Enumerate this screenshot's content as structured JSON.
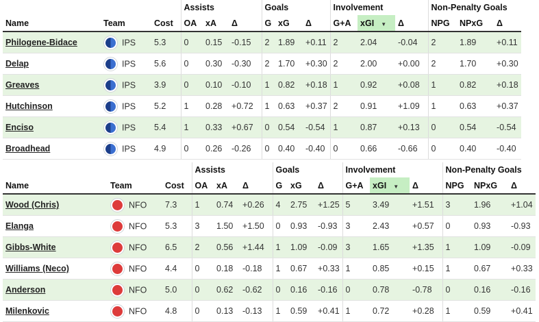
{
  "tables": [
    {
      "groups": [
        "Assists",
        "Goals",
        "Involvement",
        "Non-Penalty Goals"
      ],
      "columns": {
        "name": "Name",
        "team": "Team",
        "cost": "Cost",
        "oa": "OA",
        "xa": "xA",
        "da": "Δ",
        "g": "G",
        "xg": "xG",
        "dg": "Δ",
        "ga": "G+A",
        "xgi": "xGI",
        "dgi": "Δ",
        "npg": "NPG",
        "npxg": "NPxG",
        "dnp": "Δ"
      },
      "sort_indicator": "▼",
      "rows": [
        {
          "name": "Philogene-Bidace",
          "team": "IPS",
          "badge": "ips-crest-icon",
          "cost": "5.3",
          "oa": "0",
          "xa": "0.15",
          "da": "-0.15",
          "g": "2",
          "xg": "1.89",
          "dg": "+0.11",
          "ga": "2",
          "xgi": "2.04",
          "dgi": "-0.04",
          "npg": "2",
          "npxg": "1.89",
          "dnp": "+0.11"
        },
        {
          "name": "Delap",
          "team": "IPS",
          "badge": "ips-crest-icon",
          "cost": "5.6",
          "oa": "0",
          "xa": "0.30",
          "da": "-0.30",
          "g": "2",
          "xg": "1.70",
          "dg": "+0.30",
          "ga": "2",
          "xgi": "2.00",
          "dgi": "+0.00",
          "npg": "2",
          "npxg": "1.70",
          "dnp": "+0.30"
        },
        {
          "name": "Greaves",
          "team": "IPS",
          "badge": "ips-crest-icon",
          "cost": "3.9",
          "oa": "0",
          "xa": "0.10",
          "da": "-0.10",
          "g": "1",
          "xg": "0.82",
          "dg": "+0.18",
          "ga": "1",
          "xgi": "0.92",
          "dgi": "+0.08",
          "npg": "1",
          "npxg": "0.82",
          "dnp": "+0.18"
        },
        {
          "name": "Hutchinson",
          "team": "IPS",
          "badge": "ips-crest-icon",
          "cost": "5.2",
          "oa": "1",
          "xa": "0.28",
          "da": "+0.72",
          "g": "1",
          "xg": "0.63",
          "dg": "+0.37",
          "ga": "2",
          "xgi": "0.91",
          "dgi": "+1.09",
          "npg": "1",
          "npxg": "0.63",
          "dnp": "+0.37"
        },
        {
          "name": "Enciso",
          "team": "IPS",
          "badge": "ips-crest-icon",
          "cost": "5.4",
          "oa": "1",
          "xa": "0.33",
          "da": "+0.67",
          "g": "0",
          "xg": "0.54",
          "dg": "-0.54",
          "ga": "1",
          "xgi": "0.87",
          "dgi": "+0.13",
          "npg": "0",
          "npxg": "0.54",
          "dnp": "-0.54"
        },
        {
          "name": "Broadhead",
          "team": "IPS",
          "badge": "ips-crest-icon",
          "cost": "4.9",
          "oa": "0",
          "xa": "0.26",
          "da": "-0.26",
          "g": "0",
          "xg": "0.40",
          "dg": "-0.40",
          "ga": "0",
          "xgi": "0.66",
          "dgi": "-0.66",
          "npg": "0",
          "npxg": "0.40",
          "dnp": "-0.40"
        }
      ]
    },
    {
      "groups": [
        "Assists",
        "Goals",
        "Involvement",
        "Non-Penalty Goals"
      ],
      "columns": {
        "name": "Name",
        "team": "Team",
        "cost": "Cost",
        "oa": "OA",
        "xa": "xA",
        "da": "Δ",
        "g": "G",
        "xg": "xG",
        "dg": "Δ",
        "ga": "G+A",
        "xgi": "xGI",
        "dgi": "Δ",
        "npg": "NPG",
        "npxg": "NPxG",
        "dnp": "Δ"
      },
      "sort_indicator": "▼",
      "rows": [
        {
          "name": "Wood (Chris)",
          "team": "NFO",
          "badge": "nfo-crest-icon",
          "cost": "7.3",
          "oa": "1",
          "xa": "0.74",
          "da": "+0.26",
          "g": "4",
          "xg": "2.75",
          "dg": "+1.25",
          "ga": "5",
          "xgi": "3.49",
          "dgi": "+1.51",
          "npg": "3",
          "npxg": "1.96",
          "dnp": "+1.04"
        },
        {
          "name": "Elanga",
          "team": "NFO",
          "badge": "nfo-crest-icon",
          "cost": "5.3",
          "oa": "3",
          "xa": "1.50",
          "da": "+1.50",
          "g": "0",
          "xg": "0.93",
          "dg": "-0.93",
          "ga": "3",
          "xgi": "2.43",
          "dgi": "+0.57",
          "npg": "0",
          "npxg": "0.93",
          "dnp": "-0.93"
        },
        {
          "name": "Gibbs-White",
          "team": "NFO",
          "badge": "nfo-crest-icon",
          "cost": "6.5",
          "oa": "2",
          "xa": "0.56",
          "da": "+1.44",
          "g": "1",
          "xg": "1.09",
          "dg": "-0.09",
          "ga": "3",
          "xgi": "1.65",
          "dgi": "+1.35",
          "npg": "1",
          "npxg": "1.09",
          "dnp": "-0.09"
        },
        {
          "name": "Williams (Neco)",
          "team": "NFO",
          "badge": "nfo-crest-icon",
          "cost": "4.4",
          "oa": "0",
          "xa": "0.18",
          "da": "-0.18",
          "g": "1",
          "xg": "0.67",
          "dg": "+0.33",
          "ga": "1",
          "xgi": "0.85",
          "dgi": "+0.15",
          "npg": "1",
          "npxg": "0.67",
          "dnp": "+0.33"
        },
        {
          "name": "Anderson",
          "team": "NFO",
          "badge": "nfo-crest-icon",
          "cost": "5.0",
          "oa": "0",
          "xa": "0.62",
          "da": "-0.62",
          "g": "0",
          "xg": "0.16",
          "dg": "-0.16",
          "ga": "0",
          "xgi": "0.78",
          "dgi": "-0.78",
          "npg": "0",
          "npxg": "0.16",
          "dnp": "-0.16"
        },
        {
          "name": "Milenkovic",
          "team": "NFO",
          "badge": "nfo-crest-icon",
          "cost": "4.8",
          "oa": "0",
          "xa": "0.13",
          "da": "-0.13",
          "g": "1",
          "xg": "0.59",
          "dg": "+0.41",
          "ga": "1",
          "xgi": "0.72",
          "dgi": "+0.28",
          "npg": "1",
          "npxg": "0.59",
          "dnp": "+0.41"
        }
      ]
    }
  ]
}
